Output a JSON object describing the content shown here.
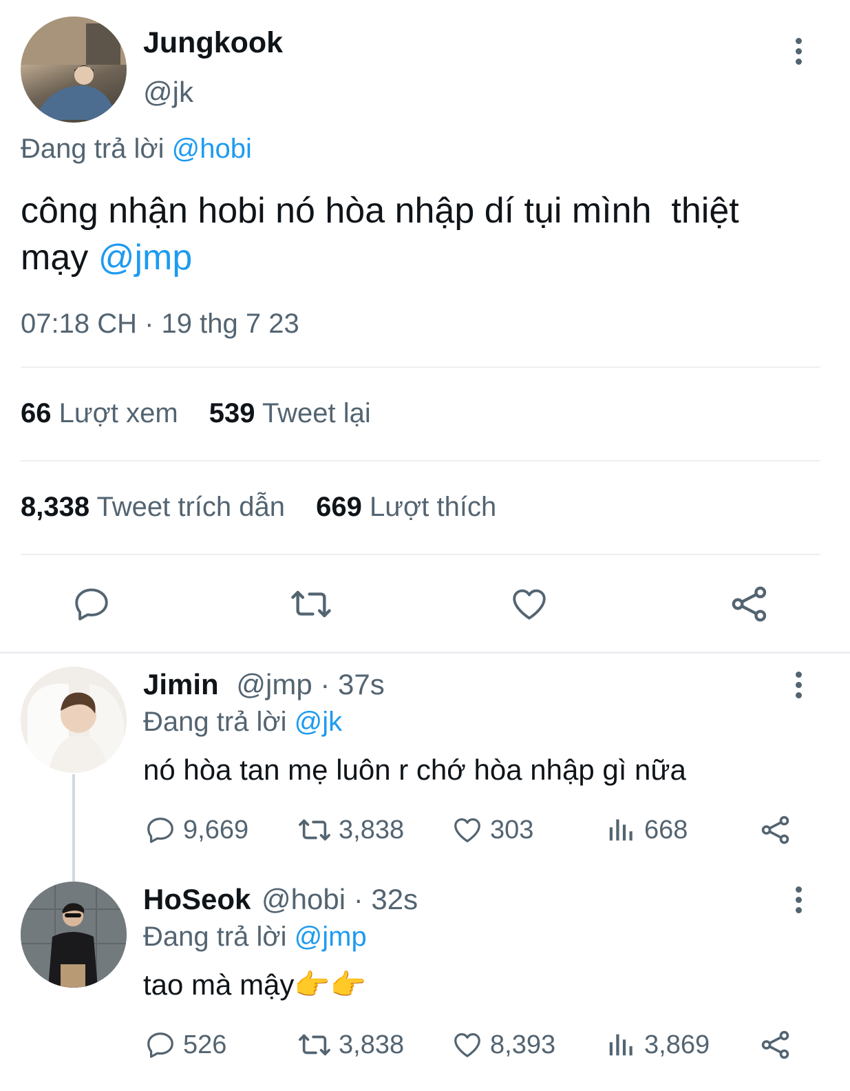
{
  "main_tweet": {
    "name": "Jungkook",
    "handle": "@jk",
    "replying_prefix": "Đang trả lời",
    "replying_to": "@hobi",
    "text_line1": "công nhận hobi nó hòa nhập dí tụi mình  thiệt",
    "text_line2": "mạy",
    "mention": "@jmp",
    "timestamp": "07:18 CH · 19 thg 7 23",
    "stats": {
      "views_num": "66",
      "views_label": "Lượt xem",
      "retweets_num": "539",
      "retweets_label": "Tweet lại",
      "quotes_num": "8,338",
      "quotes_label": "Tweet trích dẫn",
      "likes_num": "669",
      "likes_label": "Lượt thích"
    }
  },
  "replies": [
    {
      "name": "Jimin",
      "handle": "@jmp",
      "time": "· 37s",
      "replying_prefix": "Đang trả lời",
      "replying_to": "@jk",
      "text": "nó hòa tan mẹ luôn r chớ hòa nhập gì nữa",
      "replies": "9,669",
      "retweets": "3,838",
      "likes": "303",
      "views": "668"
    },
    {
      "name": "HoSeok",
      "handle": "@hobi",
      "time": "· 32s",
      "replying_prefix": "Đang trả lời",
      "replying_to": "@jmp",
      "text": "tao mà mậy",
      "emoji": "👉👉",
      "replies": "526",
      "retweets": "3,838",
      "likes": "8,393",
      "views": "3,869"
    }
  ],
  "colors": {
    "accent": "#1d9bf0",
    "muted": "#536471",
    "divider": "#eceef0"
  },
  "icons": [
    "more-icon",
    "reply-icon",
    "retweet-icon",
    "like-icon",
    "share-icon",
    "views-icon"
  ]
}
